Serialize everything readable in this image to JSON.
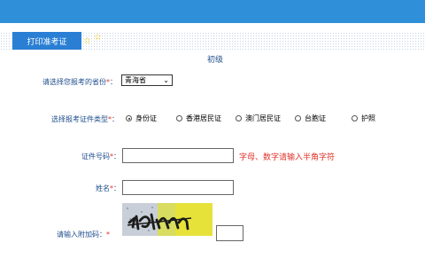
{
  "tab": {
    "label": "打印准考证"
  },
  "form": {
    "title": "初级",
    "required_mark": "*",
    "province": {
      "label": "请选择您报考的省份",
      "suffix": "：",
      "selected": "青海省"
    },
    "id_type": {
      "label": "选择报考证件类型",
      "suffix": "：",
      "options": [
        "身份证",
        "香港居民证",
        "澳门居民证",
        "台胞证",
        "护照"
      ],
      "selected": "身份证"
    },
    "id_number": {
      "label": "证件号码",
      "suffix": "：",
      "value": "",
      "hint": "字母、数字请输入半角字符"
    },
    "name": {
      "label": "姓名",
      "suffix": "：",
      "value": ""
    },
    "captcha": {
      "label": "请输入附加码：",
      "value": ""
    }
  },
  "colors": {
    "header": "#2f8fd8",
    "tab": "#2a7fd4",
    "label": "#1f4e8c",
    "required": "#e0342b",
    "captcha_bg": "#e6e23a"
  }
}
